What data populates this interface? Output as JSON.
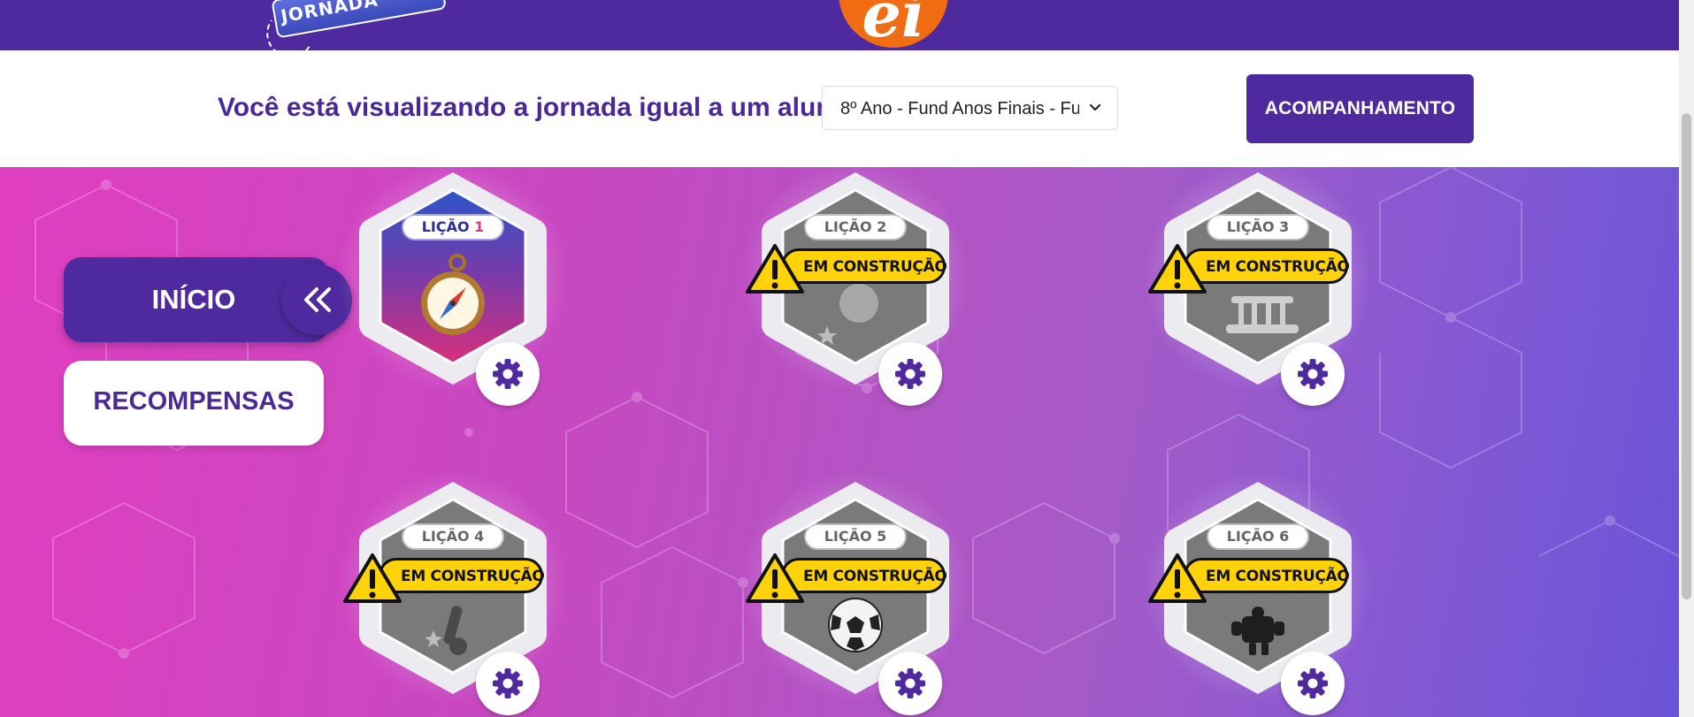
{
  "header": {
    "journey_badge_text": "JORNADA",
    "brand_mark": "ei",
    "colors": {
      "topbar": "#4f2a9e",
      "brand_orange": "#f06d14"
    }
  },
  "viewbar": {
    "label": "Você está visualizando a jornada igual a um aluno:",
    "grade_select_value": "8º Ano - Fund Anos Finais - Fu",
    "tracking_button": "ACOMPANHAMENTO"
  },
  "sidebar": {
    "inicio_label": "INÍCIO",
    "collapse_icon": "«",
    "recompensas_label": "RECOMPENSAS"
  },
  "lessons": [
    {
      "prefix": "LIÇÃO",
      "number": "1",
      "status": "active",
      "icon": "compass-icon"
    },
    {
      "prefix": "LIÇÃO",
      "number": "2",
      "status": "EM CONSTRUÇÃO",
      "icon": "rocket-icon"
    },
    {
      "prefix": "LIÇÃO",
      "number": "3",
      "status": "EM CONSTRUÇÃO",
      "icon": "building-icon"
    },
    {
      "prefix": "LIÇÃO",
      "number": "4",
      "status": "EM CONSTRUÇÃO",
      "icon": "wrench-icon"
    },
    {
      "prefix": "LIÇÃO",
      "number": "5",
      "status": "EM CONSTRUÇÃO",
      "icon": "soccer-ball-icon"
    },
    {
      "prefix": "LIÇÃO",
      "number": "6",
      "status": "EM CONSTRUÇÃO",
      "icon": "robot-icon"
    }
  ]
}
